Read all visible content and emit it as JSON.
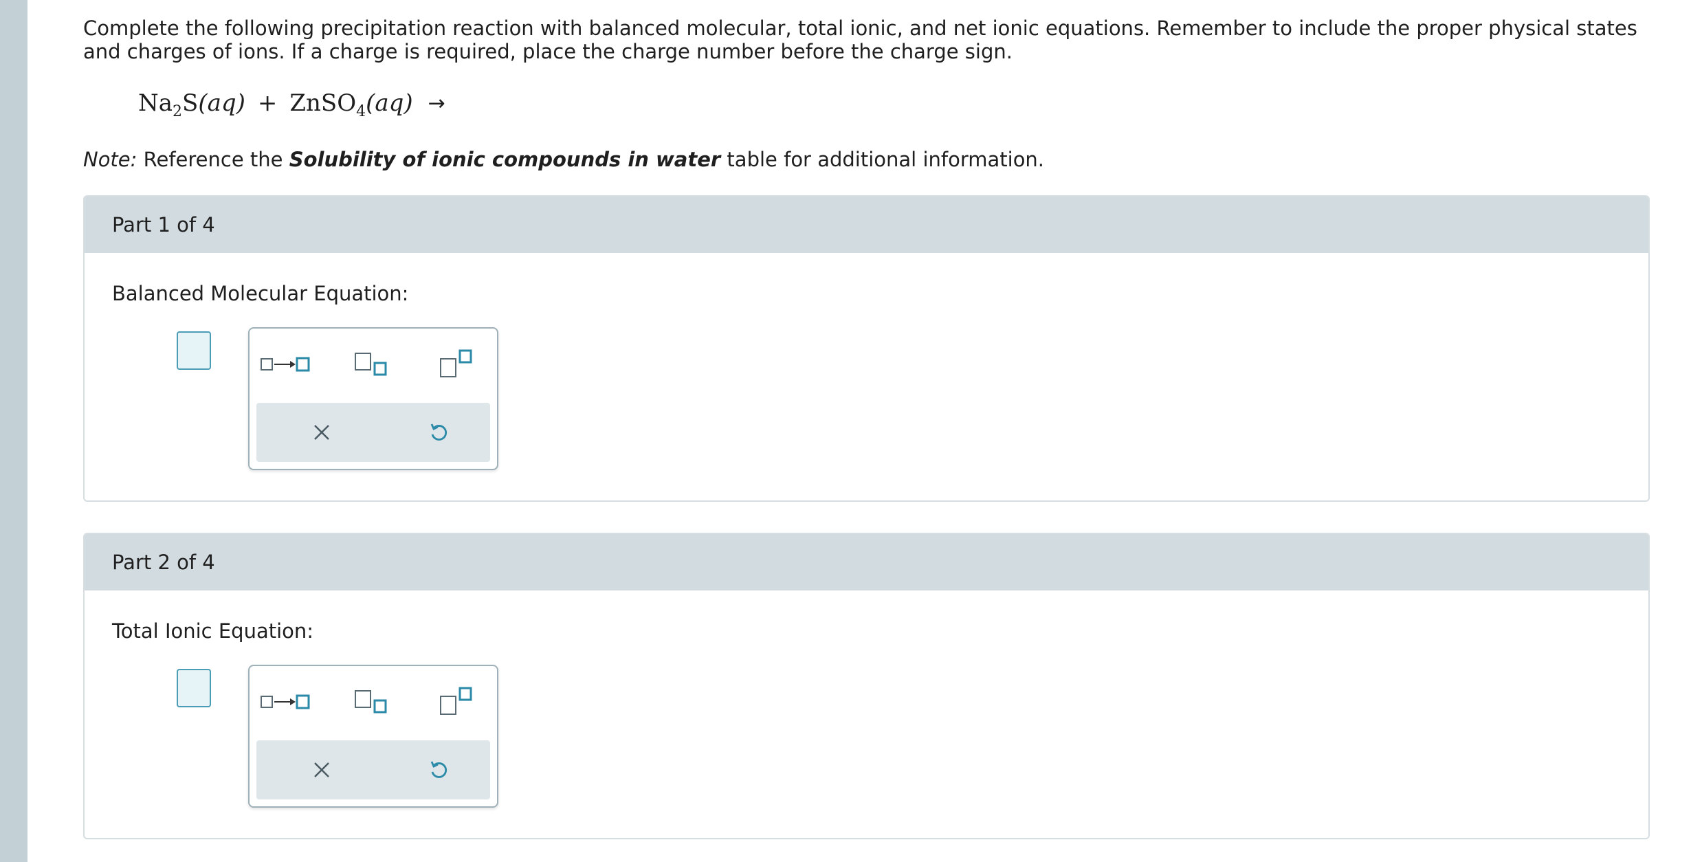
{
  "instructions": "Complete the following precipitation reaction with balanced molecular, total ionic, and net ionic equations. Remember to include the proper physical states and charges of ions. If a charge is required, place the charge number before the charge sign.",
  "reaction": {
    "r1_el": "Na",
    "r1_sub": "2",
    "r1_el2": "S",
    "r1_state": "(aq)",
    "plus": "+",
    "r2_el": "ZnSO",
    "r2_sub": "4",
    "r2_state": "(aq)",
    "arrow": "→"
  },
  "note": {
    "label": "Note:",
    "pre": " Reference the ",
    "ref": "Solubility of ionic compounds in water",
    "post": " table for additional information."
  },
  "parts": [
    {
      "header": "Part 1 of 4",
      "label": "Balanced Molecular Equation:"
    },
    {
      "header": "Part 2 of 4",
      "label": "Total Ionic Equation:"
    }
  ],
  "colors": {
    "accent": "#2a8aa8",
    "outline": "#5a6a72",
    "panel": "#d2dbdf"
  },
  "palette_icons": [
    "reaction-arrow-icon",
    "subscript-icon",
    "superscript-icon",
    "clear-icon",
    "undo-icon"
  ]
}
